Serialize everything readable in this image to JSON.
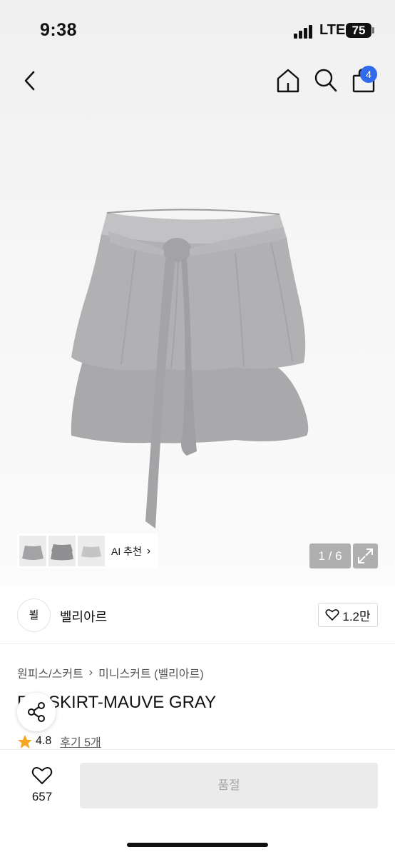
{
  "status_bar": {
    "time": "9:38",
    "network": "LTE",
    "battery": "75"
  },
  "nav": {
    "cart_count": "4"
  },
  "gallery": {
    "ai_link_label": "AI 추천",
    "page_indicator": "1 / 6"
  },
  "brand": {
    "logo_text": "뵐",
    "name": "벨리아르",
    "likes": "1.2만"
  },
  "product": {
    "breadcrumb": [
      "원피스/스커트",
      "미니스커트 (벨리아르)"
    ],
    "title": "R... SKIRT-MAUVE GRAY",
    "rating": "4.8",
    "review_link": "후기 5개"
  },
  "bottom_bar": {
    "wishlist_count": "657",
    "soldout_label": "품절"
  },
  "colors": {
    "accent_blue": "#2f6bea",
    "star": "#f5a623",
    "skirt_gray": "#aaaaad"
  },
  "icons": [
    "back-arrow-icon",
    "home-icon",
    "search-icon",
    "shopping-bag-icon",
    "expand-icon",
    "heart-icon",
    "share-icon",
    "star-icon",
    "chevron-right-icon"
  ]
}
